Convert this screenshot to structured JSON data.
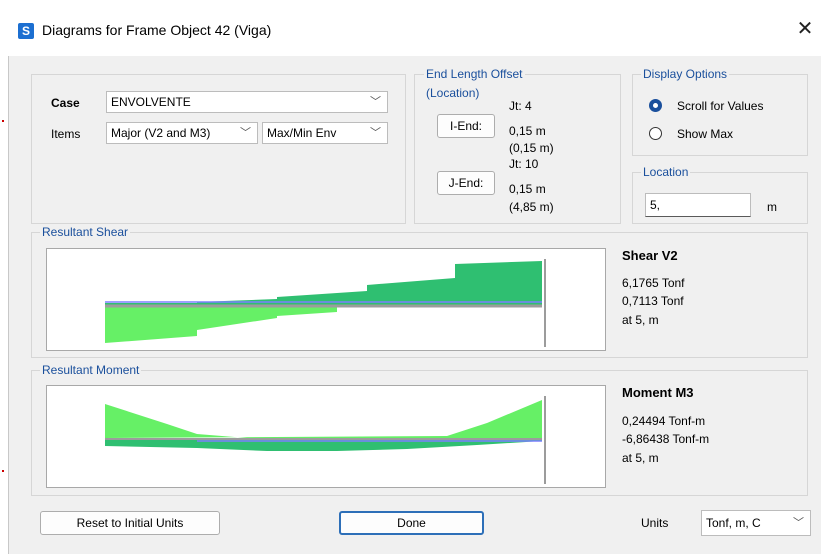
{
  "window": {
    "icon_letter": "S",
    "title": "Diagrams for Frame Object 42  (Viga)",
    "close_glyph": "✕"
  },
  "case": {
    "case_label": "Case",
    "case_value": "ENVOLVENTE",
    "items_label": "Items",
    "items_value": "Major (V2 and M3)",
    "envelope_value": "Max/Min Env"
  },
  "end_length_offset": {
    "title_line1": "End Length Offset",
    "title_line2": "(Location)",
    "iend": {
      "button": "I-End:",
      "jt": "Jt:  4",
      "length": "0,15 m",
      "location": "(0,15 m)"
    },
    "jend": {
      "button": "J-End:",
      "jt": "Jt:  10",
      "length": "0,15 m",
      "location": "(4,85 m)"
    }
  },
  "display_options": {
    "title": "Display Options",
    "scroll_label": "Scroll for Values",
    "show_max_label": "Show Max",
    "selected": "scroll"
  },
  "location": {
    "title": "Location",
    "value": "5,",
    "unit": "m"
  },
  "shear": {
    "group_title": "Resultant Shear",
    "heading": "Shear V2",
    "max": "6,1765 Tonf",
    "min": "0,7113 Tonf",
    "at": "at 5, m"
  },
  "moment": {
    "group_title": "Resultant Moment",
    "heading": "Moment M3",
    "max": "0,24494 Tonf-m",
    "min": "-6,86438 Tonf-m",
    "at": "at 5, m"
  },
  "footer": {
    "reset_label": "Reset to Initial Units",
    "done_label": "Done",
    "units_label": "Units",
    "units_value": "Tonf, m, C"
  },
  "colors": {
    "accent": "#1a4f9c",
    "light_green": "#66f066",
    "dark_green": "#2fbf71",
    "blue_line": "#7f7fff",
    "axis_gray": "#9c9c9c"
  }
}
